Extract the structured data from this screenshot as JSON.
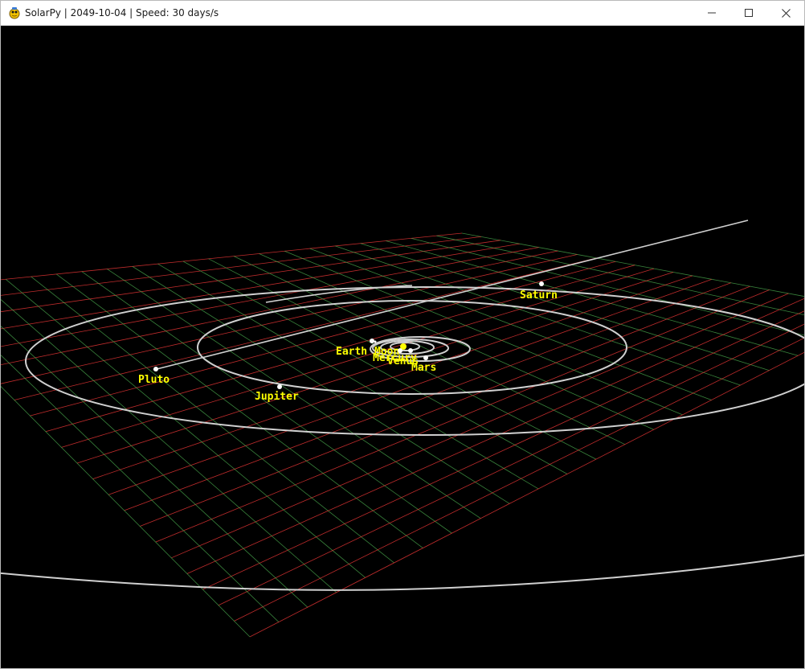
{
  "window": {
    "title": "SolarPy | 2049-10-04 | Speed: 30 days/s",
    "icon": "pygame-snake-icon",
    "controls": {
      "minimize": "minimize-icon",
      "maximize": "maximize-icon",
      "close": "close-icon"
    }
  },
  "scene": {
    "background": "#000000",
    "grid_colors": {
      "axis_a": "#ff3b3b",
      "axis_b": "#4caf50"
    },
    "orbit_color": "#d0d0d0",
    "label_color": "#ffff00",
    "planets": [
      {
        "name": "Saturn"
      },
      {
        "name": "Earth"
      },
      {
        "name": "Moon"
      },
      {
        "name": "Mercury"
      },
      {
        "name": "Venus"
      },
      {
        "name": "Mars"
      },
      {
        "name": "Pluto"
      },
      {
        "name": "Jupiter"
      }
    ]
  }
}
